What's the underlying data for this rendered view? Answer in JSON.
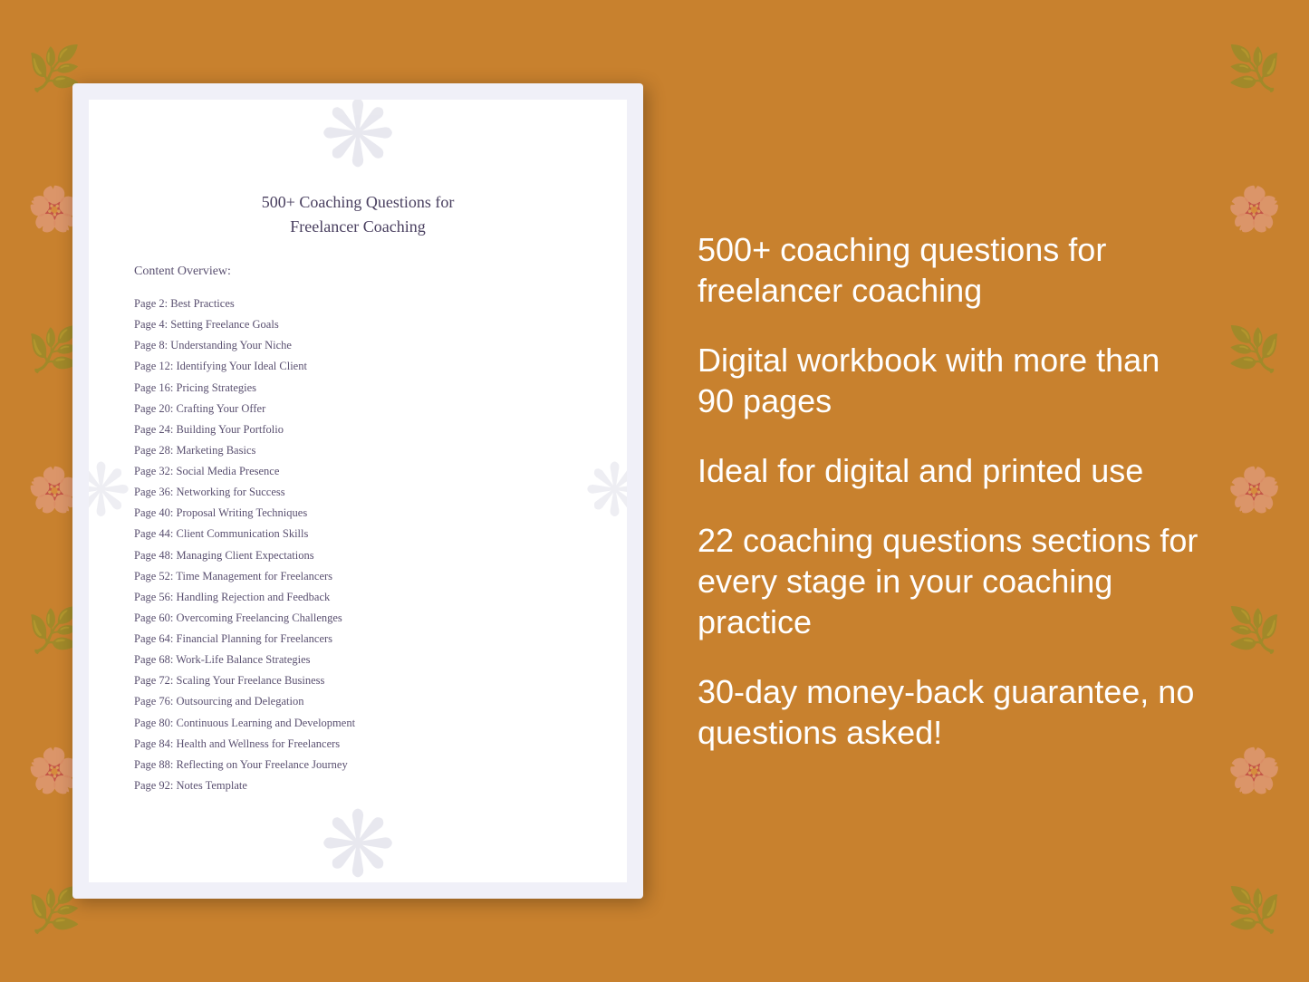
{
  "background": {
    "color": "#C8812E"
  },
  "document": {
    "title_line1": "500+ Coaching Questions for",
    "title_line2": "Freelancer Coaching",
    "content_overview_label": "Content Overview:",
    "toc_items": [
      {
        "page": "Page  2:",
        "topic": "Best Practices"
      },
      {
        "page": "Page  4:",
        "topic": "Setting Freelance Goals"
      },
      {
        "page": "Page  8:",
        "topic": "Understanding Your Niche"
      },
      {
        "page": "Page 12:",
        "topic": "Identifying Your Ideal Client"
      },
      {
        "page": "Page 16:",
        "topic": "Pricing Strategies"
      },
      {
        "page": "Page 20:",
        "topic": "Crafting Your Offer"
      },
      {
        "page": "Page 24:",
        "topic": "Building Your Portfolio"
      },
      {
        "page": "Page 28:",
        "topic": "Marketing Basics"
      },
      {
        "page": "Page 32:",
        "topic": "Social Media Presence"
      },
      {
        "page": "Page 36:",
        "topic": "Networking for Success"
      },
      {
        "page": "Page 40:",
        "topic": "Proposal Writing Techniques"
      },
      {
        "page": "Page 44:",
        "topic": "Client Communication Skills"
      },
      {
        "page": "Page 48:",
        "topic": "Managing Client Expectations"
      },
      {
        "page": "Page 52:",
        "topic": "Time Management for Freelancers"
      },
      {
        "page": "Page 56:",
        "topic": "Handling Rejection and Feedback"
      },
      {
        "page": "Page 60:",
        "topic": "Overcoming Freelancing Challenges"
      },
      {
        "page": "Page 64:",
        "topic": "Financial Planning for Freelancers"
      },
      {
        "page": "Page 68:",
        "topic": "Work-Life Balance Strategies"
      },
      {
        "page": "Page 72:",
        "topic": "Scaling Your Freelance Business"
      },
      {
        "page": "Page 76:",
        "topic": "Outsourcing and Delegation"
      },
      {
        "page": "Page 80:",
        "topic": "Continuous Learning and Development"
      },
      {
        "page": "Page 84:",
        "topic": "Health and Wellness for Freelancers"
      },
      {
        "page": "Page 88:",
        "topic": "Reflecting on Your Freelance Journey"
      },
      {
        "page": "Page 92:",
        "topic": "Notes Template"
      }
    ]
  },
  "marketing": {
    "points": [
      "500+ coaching questions for freelancer coaching",
      "Digital workbook with more than 90 pages",
      "Ideal for digital and printed use",
      "22 coaching questions sections for every stage in your coaching practice",
      "30-day money-back guarantee, no questions asked!"
    ]
  }
}
